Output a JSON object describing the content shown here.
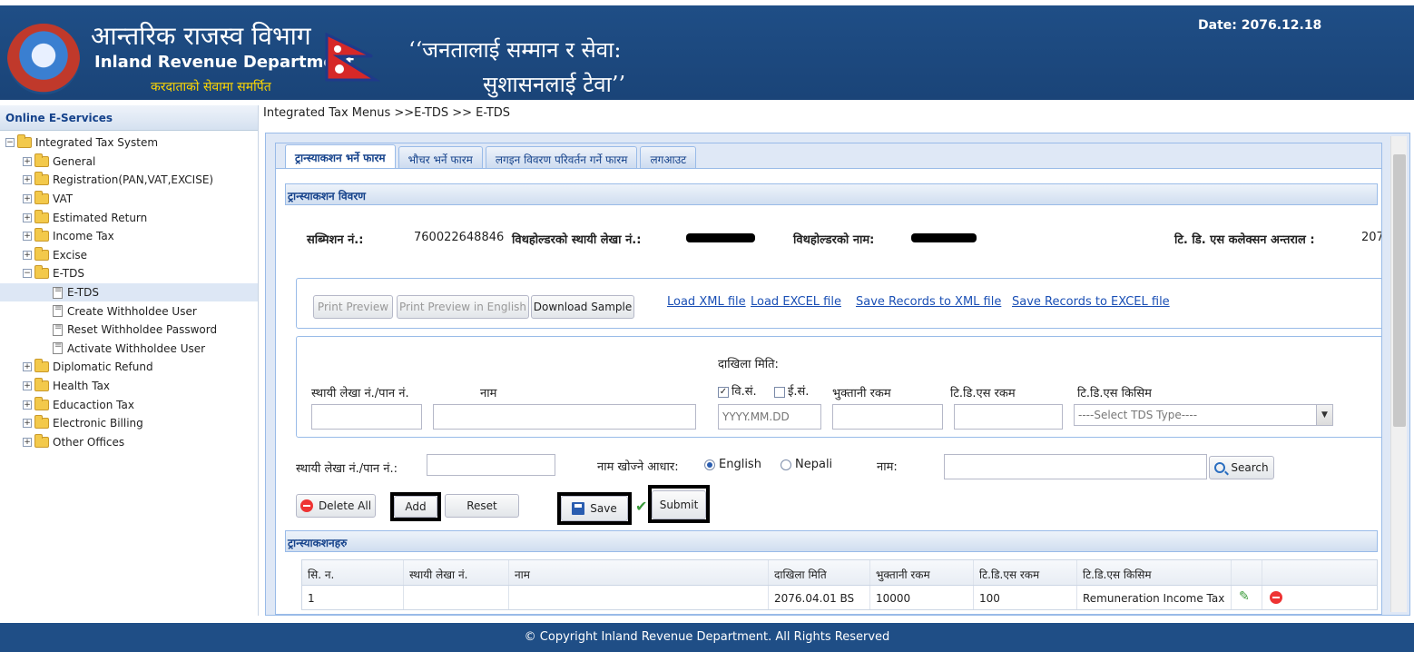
{
  "header": {
    "title_np": "आन्तरिक राजस्व विभाग",
    "title_en": "Inland Revenue Department",
    "motto": "करदाताको सेवामा समर्पित",
    "slogan_line1": "‘‘जनतालाई सम्मान र सेवा:",
    "slogan_line2": "सुशासनलाई टेवा’’",
    "date": "Date: 2076.12.18"
  },
  "sidebar": {
    "title": "Online E-Services",
    "items": [
      {
        "label": "Integrated Tax System",
        "toggle": "−"
      },
      {
        "label": "General",
        "toggle": "+"
      },
      {
        "label": "Registration(PAN,VAT,EXCISE)",
        "toggle": "+"
      },
      {
        "label": "VAT",
        "toggle": "+"
      },
      {
        "label": "Estimated Return",
        "toggle": "+"
      },
      {
        "label": "Income Tax",
        "toggle": "+"
      },
      {
        "label": "Excise",
        "toggle": "+"
      },
      {
        "label": "E-TDS",
        "toggle": "−"
      },
      {
        "label": "E-TDS"
      },
      {
        "label": "Create Withholdee User"
      },
      {
        "label": "Reset Withholdee Password"
      },
      {
        "label": "Activate Withholdee User"
      },
      {
        "label": "Diplomatic Refund",
        "toggle": "+"
      },
      {
        "label": "Health Tax",
        "toggle": "+"
      },
      {
        "label": "Educaction Tax",
        "toggle": "+"
      },
      {
        "label": "Electronic Billing",
        "toggle": "+"
      },
      {
        "label": "Other Offices",
        "toggle": "+"
      }
    ]
  },
  "breadcrumb": "Integrated Tax Menus >>E-TDS >> E-TDS",
  "tabs": [
    {
      "label": "ट्रान्स्याकशन भर्ने फारम"
    },
    {
      "label": "भौचर भर्ने फारम"
    },
    {
      "label": "लगइन विवरण परिवर्तन गर्ने फारम"
    },
    {
      "label": "लगआउट"
    }
  ],
  "section_title": "ट्रान्स्याकशन विवरण",
  "info": {
    "submission_label": "सब्मिशन नं.:",
    "submission_value": "760022648846",
    "withholder_pan_label": "विथहोल्डरको स्थायी लेखा नं.:",
    "withholder_name_label": "विथहोल्डरको नाम:",
    "collection_label": "टि. डि. एस कलेक्सन अन्तराल :",
    "collection_value": "207"
  },
  "toolbar": {
    "print_preview": "Print Preview",
    "print_preview_en": "Print Preview in English",
    "download_sample": "Download Sample",
    "load_xml": "Load XML file",
    "load_excel": "Load EXCEL file",
    "save_xml": "Save Records to XML file",
    "save_excel": "Save Records to EXCEL file"
  },
  "entry_form": {
    "date_group_label": "दाखिला मिति:",
    "pan_label": "स्थायी लेखा नं./पान नं.",
    "name_label": "नाम",
    "bs_label": "वि.सं.",
    "ad_label": "ई.सं.",
    "payment_label": "भुक्तानी रकम",
    "tds_amount_label": "टि.डि.एस रकम",
    "tds_type_label": "टि.डि.एस किसिम",
    "date_placeholder": "YYYY.MM.DD",
    "tds_type_select": "----Select TDS Type----"
  },
  "search_row": {
    "pan_label": "स्थायी लेखा नं./पान नं.:",
    "search_basis_label": "नाम खोज्ने आधार:",
    "english": "English",
    "nepali": "Nepali",
    "name_label": "नाम:",
    "search_button": "Search"
  },
  "actions": {
    "delete_all": "Delete All",
    "add": "Add",
    "reset": "Reset",
    "save": "Save",
    "submit": "Submit"
  },
  "transactions_title": "ट्रान्स्याकशनहरु",
  "grid": {
    "columns": [
      "सि. न.",
      "स्थायी लेखा नं.",
      "नाम",
      "दाखिला मिति",
      "भुक्तानी रकम",
      "टि.डि.एस रकम",
      "टि.डि.एस किसिम"
    ],
    "rows": [
      {
        "sn": "1",
        "pan": "",
        "name": "",
        "date": "2076.04.01 BS",
        "payment": "10000",
        "tds": "100",
        "type": "Remuneration Income Tax"
      }
    ]
  },
  "footer": "© Copyright Inland Revenue Department. All Rights Reserved",
  "colors": {
    "header_bg": "#1f4e86",
    "accent": "#15428b",
    "link": "#1a4fb5",
    "motto": "#ffd700"
  }
}
